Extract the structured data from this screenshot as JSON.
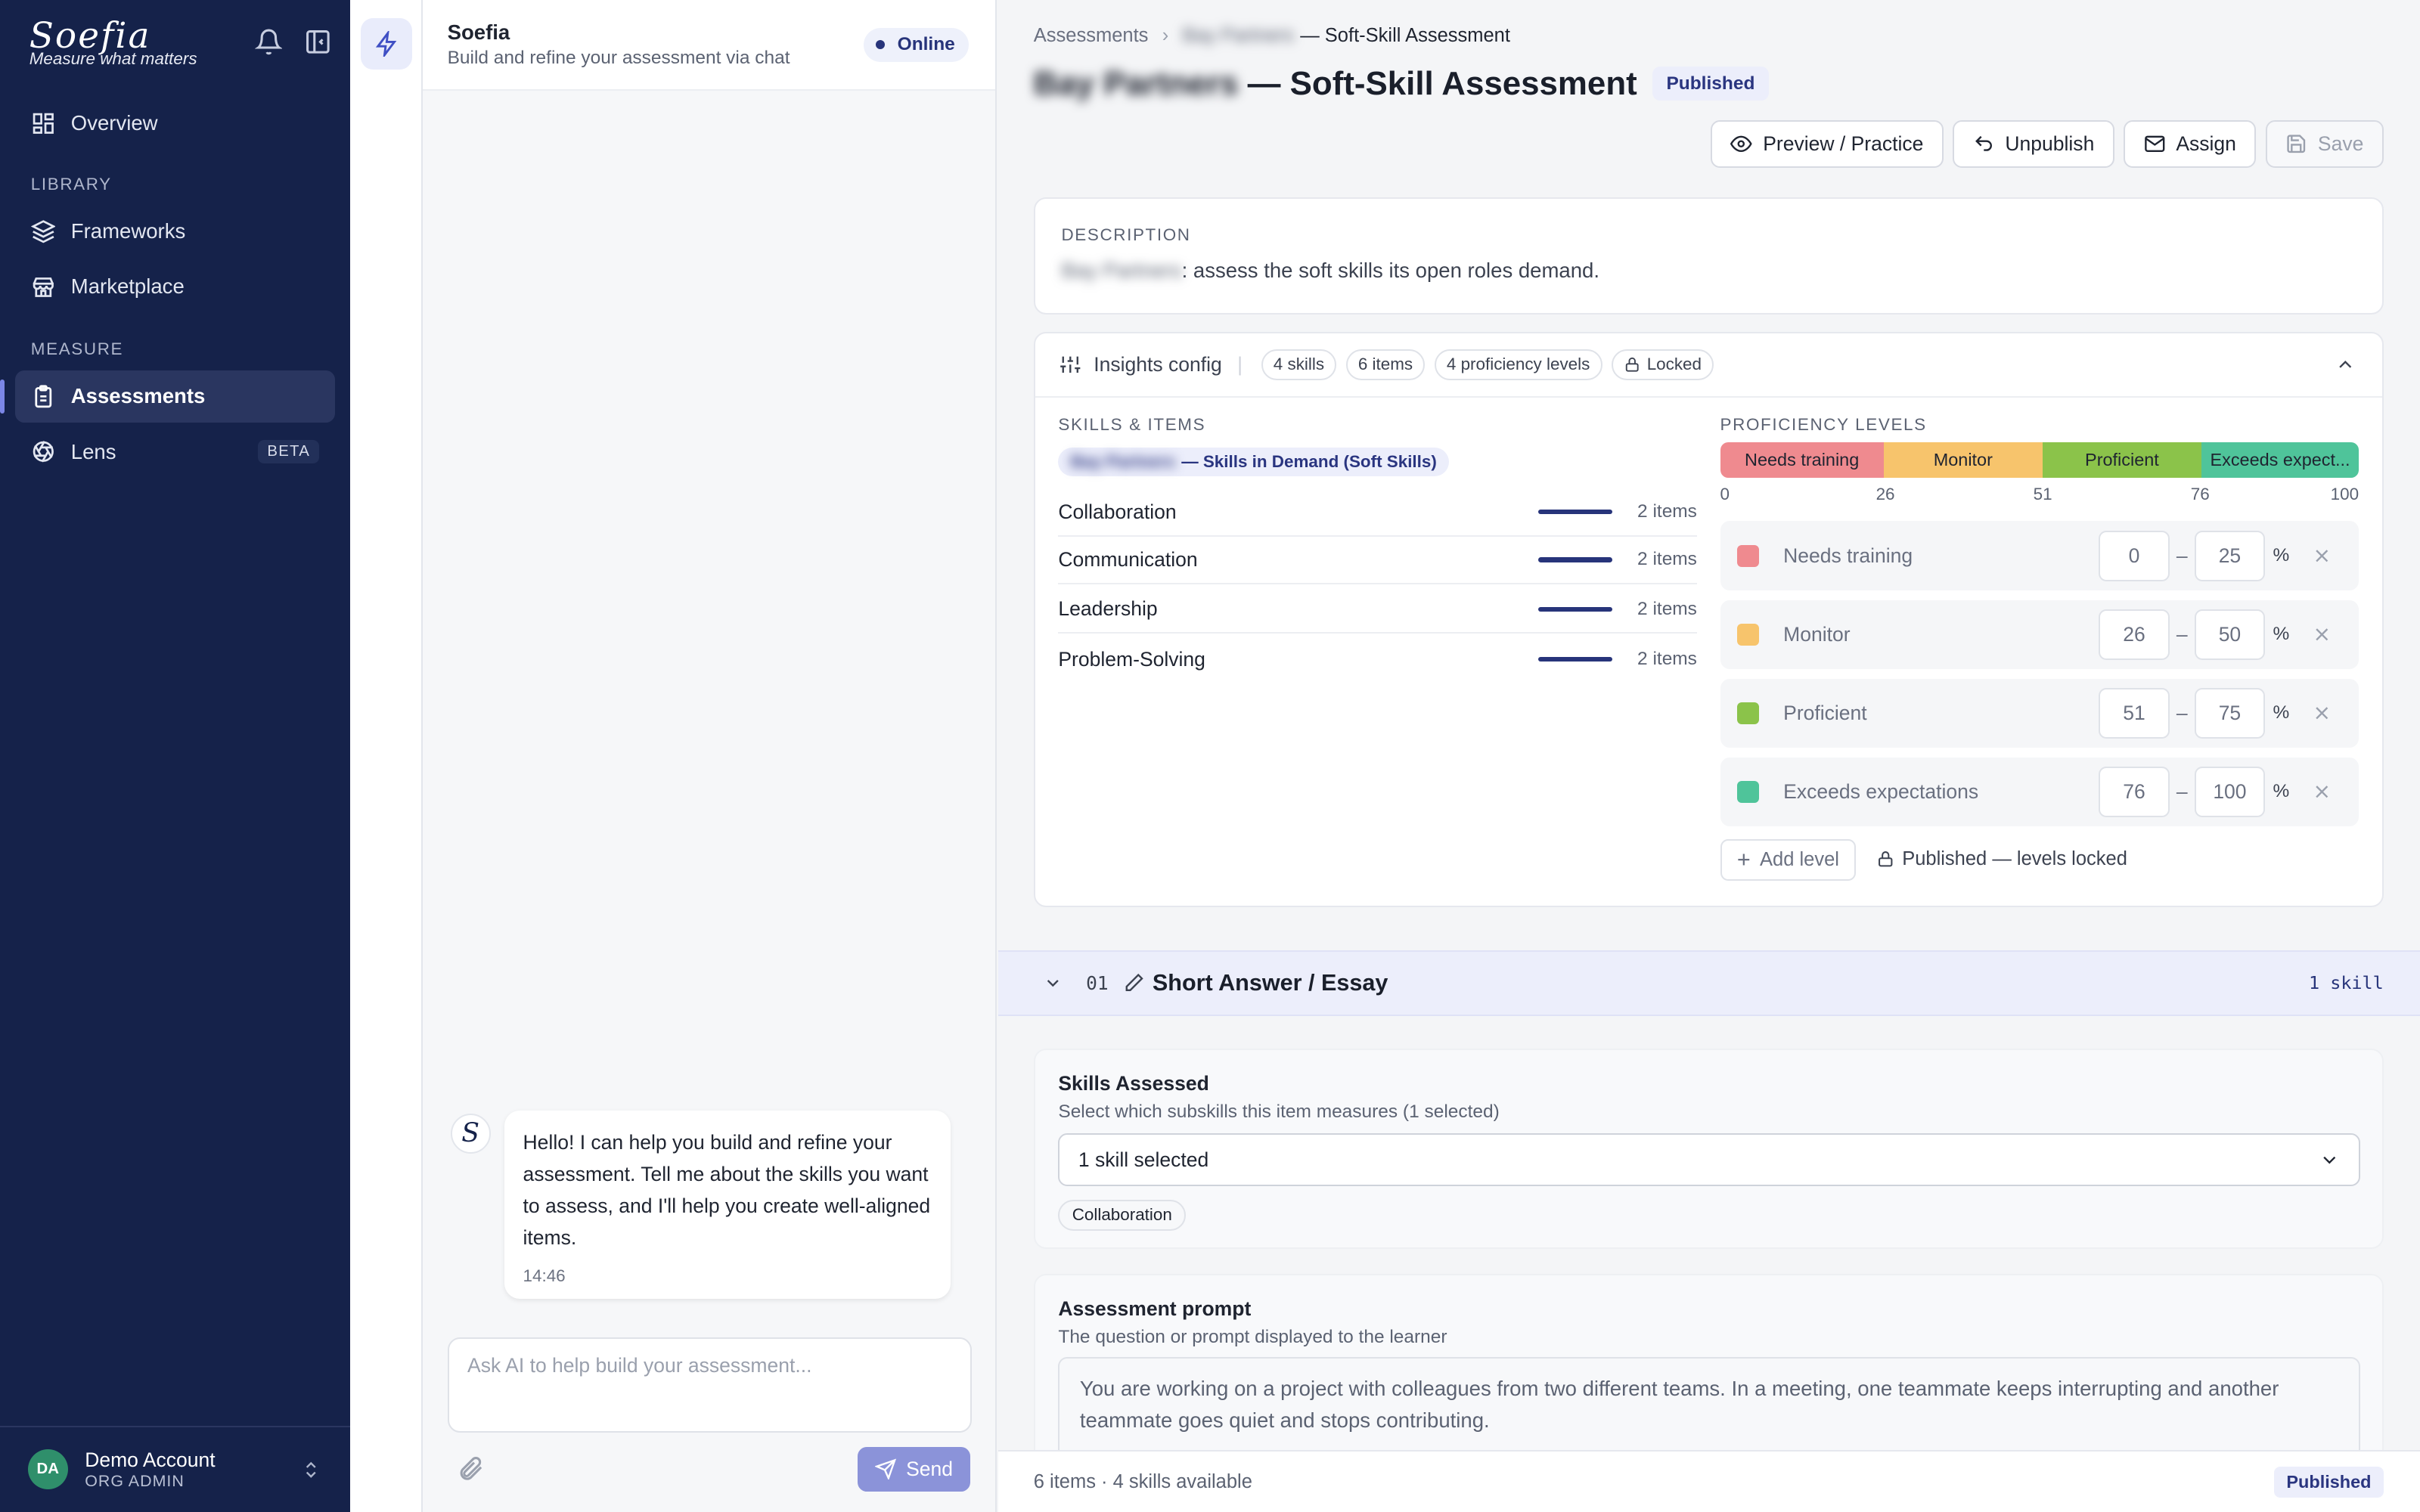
{
  "brand": {
    "logo": "Soefia",
    "tagline": "Measure what matters"
  },
  "sidebar": {
    "overview": "Overview",
    "library_label": "LIBRARY",
    "frameworks": "Frameworks",
    "marketplace": "Marketplace",
    "measure_label": "MEASURE",
    "assessments": "Assessments",
    "lens": "Lens",
    "lens_badge": "BETA",
    "account": {
      "initials": "DA",
      "name": "Demo Account",
      "role": "ORG ADMIN"
    }
  },
  "chat": {
    "title": "Soefia",
    "subtitle": "Build and refine your assessment via chat",
    "status": "Online",
    "bot_avatar": "S",
    "message": "Hello! I can help you build and refine your assessment. Tell me about the skills you want to assess, and I'll help you create well-aligned items.",
    "message_time": "14:46",
    "input_placeholder": "Ask AI to help build your assessment...",
    "send_label": "Send"
  },
  "breadcrumb": {
    "root": "Assessments",
    "redacted_org": "Bay Partners",
    "current_suffix": "— Soft-Skill Assessment"
  },
  "page": {
    "redacted_org": "Bay Partners",
    "title_suffix": "— Soft-Skill Assessment",
    "status": "Published"
  },
  "toolbar": {
    "preview": "Preview / Practice",
    "unpublish": "Unpublish",
    "assign": "Assign",
    "save": "Save"
  },
  "description": {
    "label": "DESCRIPTION",
    "redacted_org": "Bay Partners",
    "text": ": assess the soft skills its open roles demand."
  },
  "insights": {
    "label": "Insights config",
    "chips": [
      "4 skills",
      "6 items",
      "4 proficiency levels"
    ],
    "locked": "Locked",
    "skills_label": "SKILLS & ITEMS",
    "framework_redacted": "Bay Partners",
    "framework_suffix": "— Skills in Demand (Soft Skills)",
    "skills": [
      {
        "name": "Collaboration",
        "items": "2 items"
      },
      {
        "name": "Communication",
        "items": "2 items"
      },
      {
        "name": "Leadership",
        "items": "2 items"
      },
      {
        "name": "Problem-Solving",
        "items": "2 items"
      }
    ],
    "proficiency_label": "PROFICIENCY LEVELS",
    "bar_labels": [
      "Needs training",
      "Monitor",
      "Proficient",
      "Exceeds expect..."
    ],
    "ticks": [
      "0",
      "26",
      "51",
      "76",
      "100"
    ],
    "levels": [
      {
        "name": "Needs training",
        "min": "0",
        "max": "25",
        "color": "#ef8a8f"
      },
      {
        "name": "Monitor",
        "min": "26",
        "max": "50",
        "color": "#f7c46c"
      },
      {
        "name": "Proficient",
        "min": "51",
        "max": "75",
        "color": "#8bc34a"
      },
      {
        "name": "Exceeds expectations",
        "min": "76",
        "max": "100",
        "color": "#4fc49a"
      }
    ],
    "pct_sign": "%",
    "add_level": "Add level",
    "locked_note": "Published — levels locked"
  },
  "item": {
    "number": "01",
    "title": "Short Answer / Essay",
    "skill_count": "1 skill",
    "skills_title": "Skills Assessed",
    "skills_sub": "Select which subskills this item measures (1 selected)",
    "select_value": "1 skill selected",
    "tag": "Collaboration",
    "prompt_title": "Assessment prompt",
    "prompt_sub": "The question or prompt displayed to the learner",
    "prompt_text": "You are working on a project with colleagues from two different teams. In a meeting, one teammate keeps interrupting and another teammate goes quiet and stops contributing."
  },
  "footer": {
    "summary": "6 items · 4 skills available",
    "status": "Published"
  }
}
